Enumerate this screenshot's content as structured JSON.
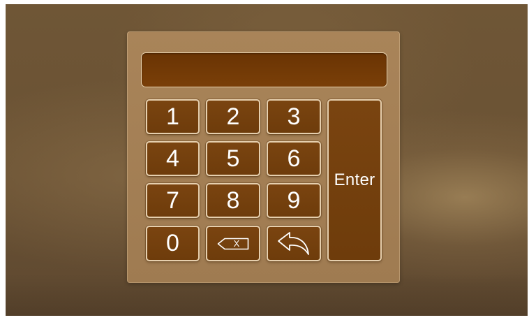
{
  "keypad": {
    "display_value": "",
    "keys": [
      "1",
      "2",
      "3",
      "4",
      "5",
      "6",
      "7",
      "8",
      "9",
      "0"
    ],
    "enter_label": "Enter",
    "backspace_icon": "backspace-icon",
    "backspace_glyph": "X",
    "back_icon": "back-arrow-icon"
  },
  "colors": {
    "panel": "#a98459",
    "key_fill": "#72400d",
    "key_border": "#e6cfae",
    "display_fill": "#6a3404",
    "text": "#ffffff"
  }
}
